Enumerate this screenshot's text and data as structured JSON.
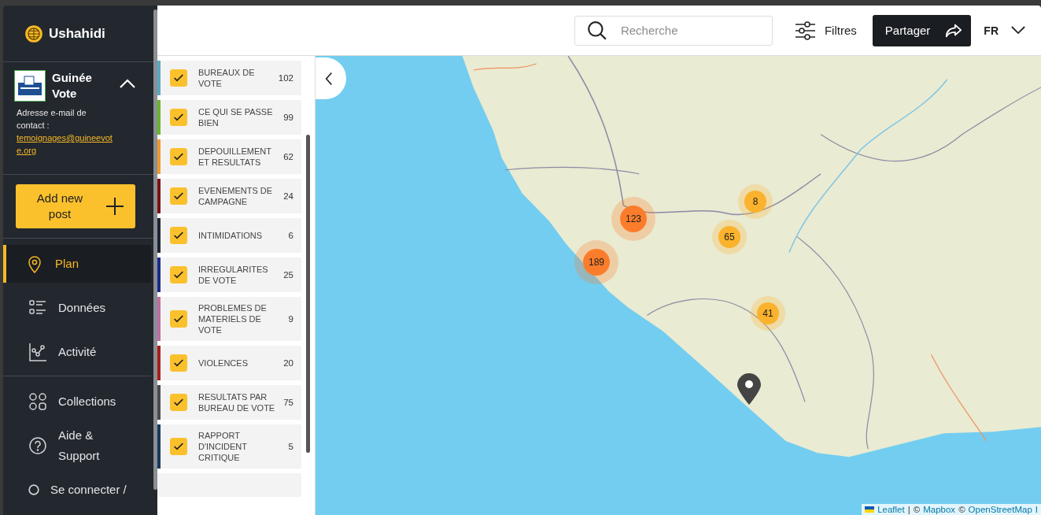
{
  "brand": {
    "name": "Ushahidi"
  },
  "deployment": {
    "name": "Guinée Vote",
    "expanded": true,
    "contact_label": "Adresse e-mail de contact :",
    "email": "temoignages@guineevote.org"
  },
  "add_post": {
    "label": "Add new post"
  },
  "nav": [
    {
      "label": "Plan",
      "selected": true
    },
    {
      "label": "Données",
      "selected": false
    },
    {
      "label": "Activité",
      "selected": false
    },
    {
      "label": "Collections",
      "selected": false
    },
    {
      "label": "Aide & Support",
      "selected": false
    },
    {
      "label": "Se connecter /",
      "selected": false
    }
  ],
  "search": {
    "placeholder": "Recherche"
  },
  "filters": {
    "label": "Filtres"
  },
  "share": {
    "label": "Partager"
  },
  "language": {
    "label": "FR"
  },
  "categories": [
    {
      "label": "BUREAUX DE VOTE",
      "count": "102",
      "checked": true,
      "color": "#5aa9c2"
    },
    {
      "label": "CE QUI SE PASSE BIEN",
      "count": "99",
      "checked": true,
      "color": "#69b62a"
    },
    {
      "label": "DEPOUILLEMENT ET RESULTATS",
      "count": "62",
      "checked": true,
      "color": "#ef9a2e"
    },
    {
      "label": "EVENEMENTS DE CAMPAGNE",
      "count": "24",
      "checked": true,
      "color": "#7a1212"
    },
    {
      "label": "INTIMIDATIONS",
      "count": "6",
      "checked": true,
      "color": "#1c2633"
    },
    {
      "label": "IRREGULARITES DE VOTE",
      "count": "25",
      "checked": true,
      "color": "#1b2a8c"
    },
    {
      "label": "PROBLEMES DE MATERIELS DE VOTE",
      "count": "9",
      "checked": true,
      "color": "#c06ea2"
    },
    {
      "label": "VIOLENCES",
      "count": "20",
      "checked": true,
      "color": "#a81d1d"
    },
    {
      "label": "RESULTATS PAR BUREAU DE VOTE",
      "count": "75",
      "checked": true,
      "color": "#4a4a4a"
    },
    {
      "label": "RAPPORT D'INCIDENT CRITIQUE",
      "count": "5",
      "checked": true,
      "color": "#173a5c"
    }
  ],
  "map": {
    "clusters": [
      {
        "count": "123",
        "color": "#fb7d2b"
      },
      {
        "count": "189",
        "color": "#fb7d2b"
      },
      {
        "count": "8",
        "color": "#fbb22c"
      },
      {
        "count": "65",
        "color": "#fbb22c"
      },
      {
        "count": "41",
        "color": "#fbb22c"
      }
    ],
    "attribution": [
      {
        "text": "Leaflet",
        "kind": "link"
      },
      {
        "text": "|",
        "kind": "text"
      },
      {
        "text": "©",
        "kind": "text"
      },
      {
        "text": "Mapbox",
        "kind": "link"
      },
      {
        "text": "©",
        "kind": "text"
      },
      {
        "text": "OpenStreetMap",
        "kind": "link"
      },
      {
        "text": "I",
        "kind": "link"
      }
    ]
  }
}
